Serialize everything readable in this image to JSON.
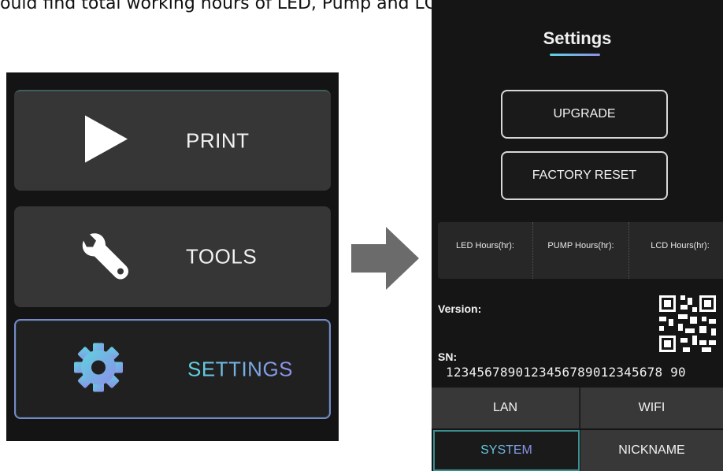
{
  "caption": "ould find total working hours of LED, Pump and LCD in this interface, to",
  "left_menu": {
    "items": [
      {
        "label": "PRINT",
        "icon": "play-icon"
      },
      {
        "label": "TOOLS",
        "icon": "wrench-icon"
      },
      {
        "label": "SETTINGS",
        "icon": "gear-icon",
        "selected": true
      }
    ]
  },
  "settings_screen": {
    "title": "Settings",
    "upgrade_label": "UPGRADE",
    "factory_reset_label": "FACTORY RESET",
    "hours": {
      "led_label": "LED Hours(hr):",
      "pump_label": "PUMP Hours(hr):",
      "lcd_label": "LCD Hours(hr):"
    },
    "version_label": "Version:",
    "sn_label": "SN:",
    "sn_value": "1234567890123456789012345678 90",
    "tabs": {
      "lan": "LAN",
      "wifi": "WIFI",
      "system": "SYSTEM",
      "nickname": "NICKNAME"
    }
  },
  "colors": {
    "accent_start": "#5fd3e0",
    "accent_end": "#8d8ee8",
    "arrow": "#6b6b6b"
  }
}
